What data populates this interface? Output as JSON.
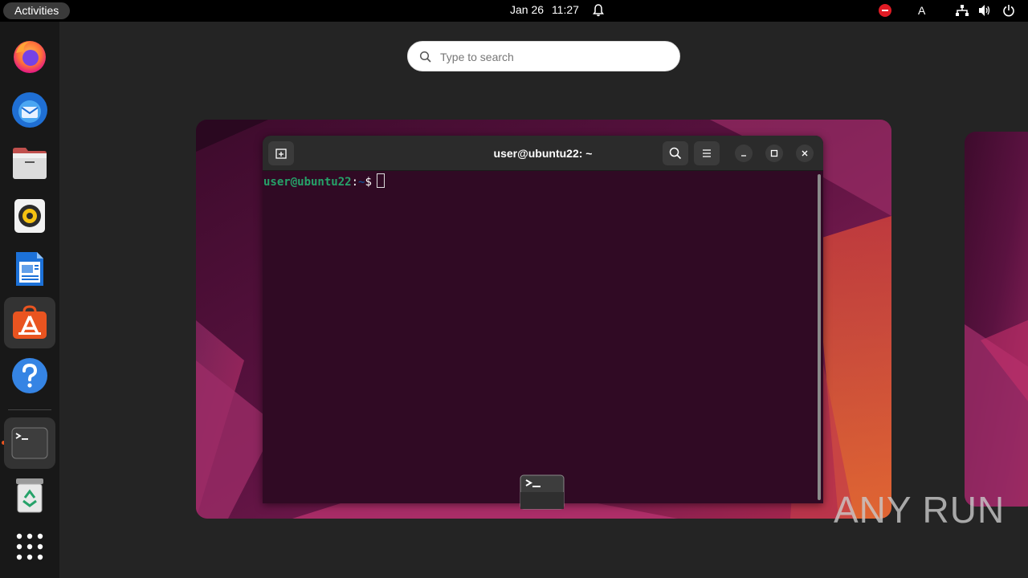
{
  "topbar": {
    "activities": "Activities",
    "date": "Jan 26",
    "time": "11:27",
    "keyboard_layout": "A"
  },
  "dock": {
    "items": [
      {
        "name": "Firefox"
      },
      {
        "name": "Thunderbird Mail"
      },
      {
        "name": "Files"
      },
      {
        "name": "Rhythmbox"
      },
      {
        "name": "LibreOffice Writer"
      },
      {
        "name": "Ubuntu Software"
      },
      {
        "name": "Help"
      },
      {
        "name": "Terminal"
      },
      {
        "name": "Trash"
      },
      {
        "name": "Show Applications"
      }
    ]
  },
  "search": {
    "placeholder": "Type to search"
  },
  "terminal": {
    "title": "user@ubuntu22: ~",
    "prompt_user": "user@ubuntu22",
    "prompt_sep": ":",
    "prompt_path": "~",
    "prompt_symbol": "$"
  },
  "watermark": "ANY RUN",
  "colors": {
    "accent": "#e95420",
    "terminal_bg": "#300a24",
    "prompt_user": "#26a269",
    "prompt_path": "#12488b"
  }
}
